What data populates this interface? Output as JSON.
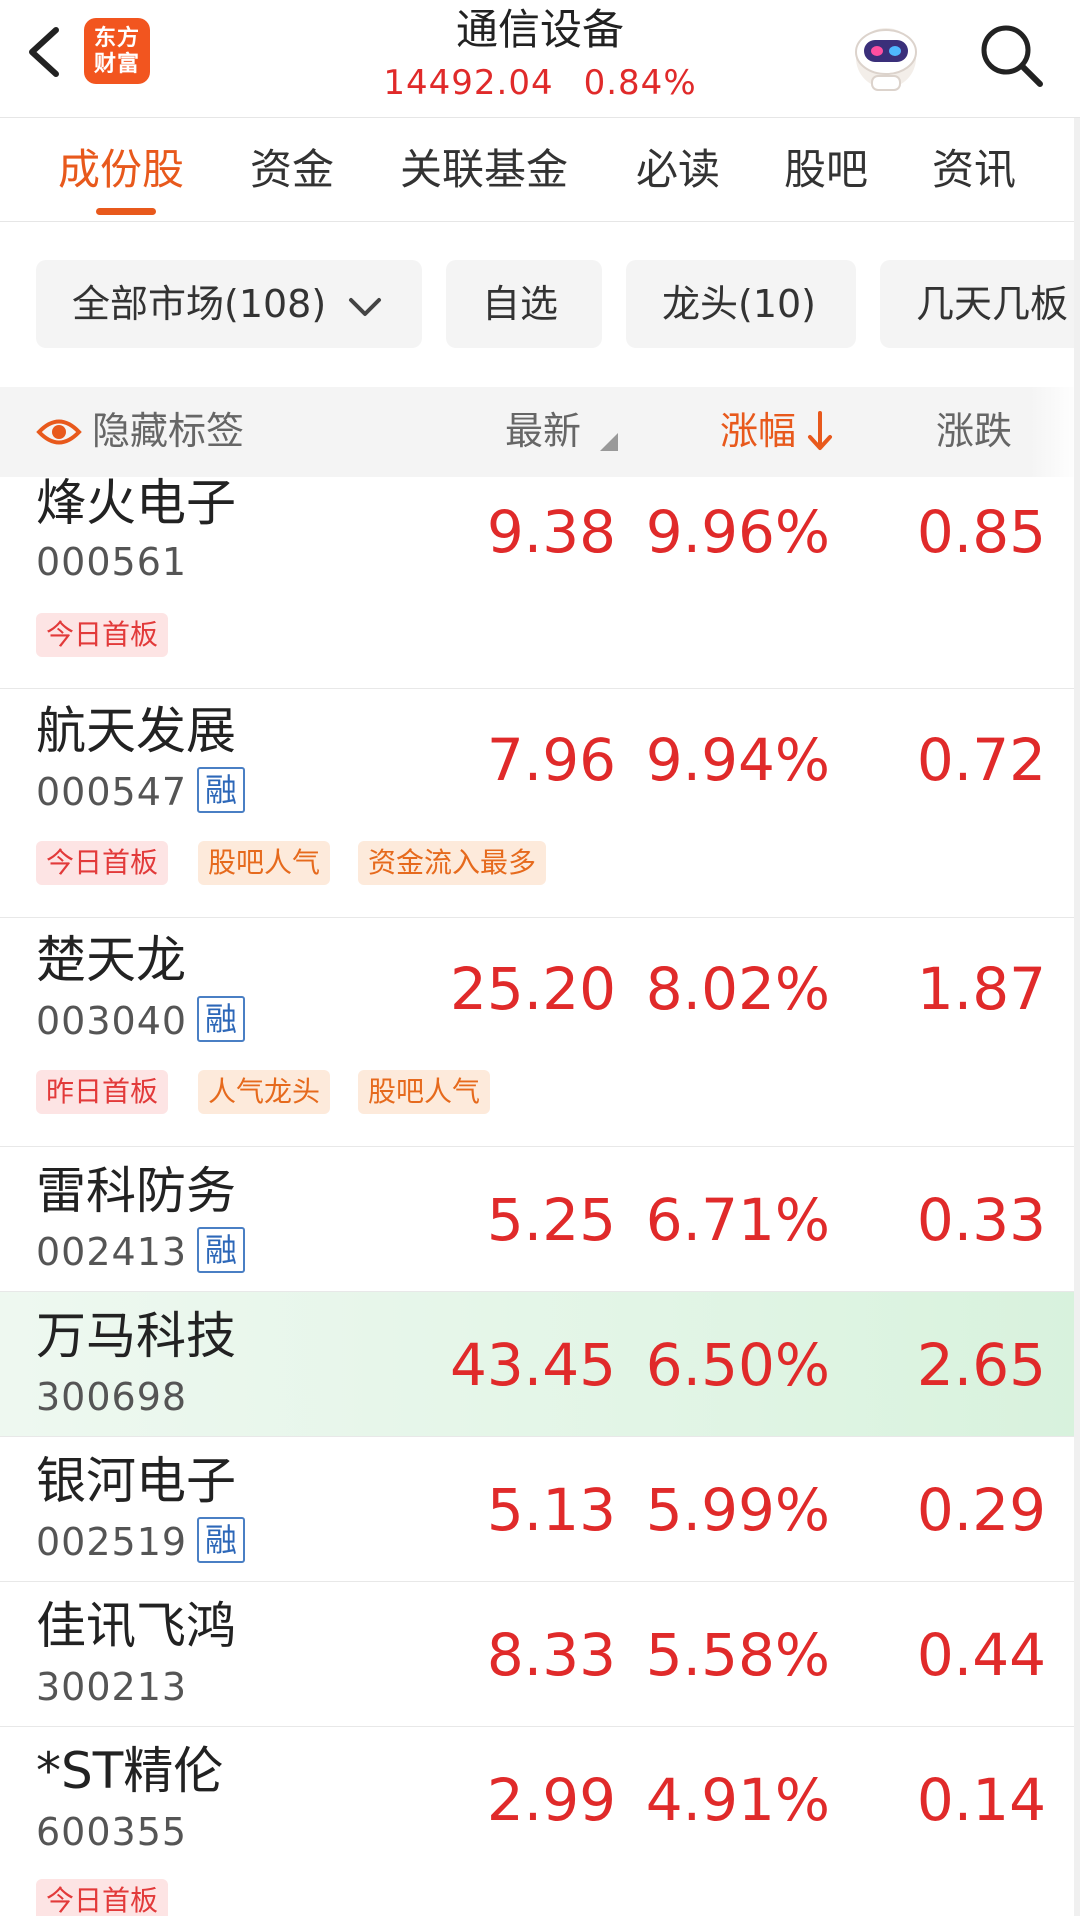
{
  "header": {
    "logo_text": "东方财富",
    "logo_line1": "东方",
    "logo_line2": "财富",
    "title": "通信设备",
    "index_value": "14492.04",
    "index_change": "0.84%",
    "back_icon": "chevron-left-icon",
    "assistant_icon": "robot-assistant-icon",
    "search_icon": "search-icon"
  },
  "tabs": [
    {
      "label": "成份股",
      "active": true
    },
    {
      "label": "资金",
      "active": false
    },
    {
      "label": "关联基金",
      "active": false
    },
    {
      "label": "必读",
      "active": false
    },
    {
      "label": "股吧",
      "active": false
    },
    {
      "label": "资讯",
      "active": false
    }
  ],
  "filters": [
    {
      "label": "全部市场(108)",
      "has_dropdown": true
    },
    {
      "label": "自选"
    },
    {
      "label": "龙头(10)"
    },
    {
      "label": "几天几板"
    }
  ],
  "columns": {
    "hide_tags": "隐藏标签",
    "latest": "最新",
    "change_pct": "涨幅",
    "change_amt": "涨跌",
    "sort_column": "change_pct",
    "sort_direction": "desc"
  },
  "colors": {
    "accent": "#e8591c",
    "up": "#e02a2a",
    "highlight_row": "#e2f5e6"
  },
  "stocks": [
    {
      "name": "烽火电子",
      "code": "000561",
      "margin": false,
      "latest": "9.38",
      "change_pct": "9.96%",
      "change_amt": "0.85",
      "tags": [
        {
          "text": "今日首板",
          "style": "red"
        }
      ]
    },
    {
      "name": "航天发展",
      "code": "000547",
      "margin": true,
      "latest": "7.96",
      "change_pct": "9.94%",
      "change_amt": "0.72",
      "tags": [
        {
          "text": "今日首板",
          "style": "red"
        },
        {
          "text": "股吧人气",
          "style": "orange"
        },
        {
          "text": "资金流入最多",
          "style": "orange"
        }
      ]
    },
    {
      "name": "楚天龙",
      "code": "003040",
      "margin": true,
      "latest": "25.20",
      "change_pct": "8.02%",
      "change_amt": "1.87",
      "tags": [
        {
          "text": "昨日首板",
          "style": "red"
        },
        {
          "text": "人气龙头",
          "style": "orange"
        },
        {
          "text": "股吧人气",
          "style": "orange"
        }
      ]
    },
    {
      "name": "雷科防务",
      "code": "002413",
      "margin": true,
      "latest": "5.25",
      "change_pct": "6.71%",
      "change_amt": "0.33",
      "tags": []
    },
    {
      "name": "万马科技",
      "code": "300698",
      "margin": false,
      "latest": "43.45",
      "change_pct": "6.50%",
      "change_amt": "2.65",
      "tags": [],
      "highlighted": true
    },
    {
      "name": "银河电子",
      "code": "002519",
      "margin": true,
      "latest": "5.13",
      "change_pct": "5.99%",
      "change_amt": "0.29",
      "tags": []
    },
    {
      "name": "佳讯飞鸿",
      "code": "300213",
      "margin": false,
      "latest": "8.33",
      "change_pct": "5.58%",
      "change_amt": "0.44",
      "tags": []
    },
    {
      "name": "*ST精伦",
      "code": "600355",
      "margin": false,
      "latest": "2.99",
      "change_pct": "4.91%",
      "change_amt": "0.14",
      "tags": [
        {
          "text": "今日首板",
          "style": "red"
        }
      ]
    }
  ],
  "margin_badge": "融"
}
